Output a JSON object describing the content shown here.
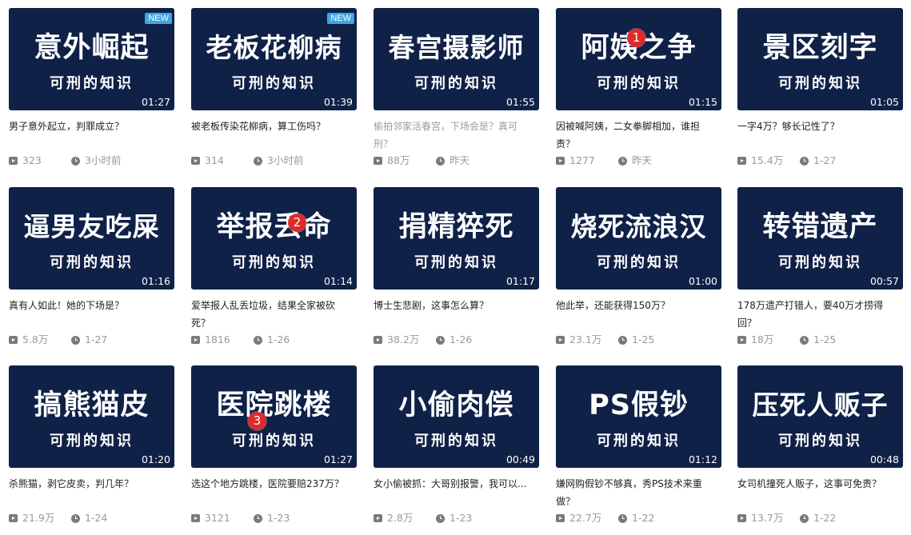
{
  "videos": [
    {
      "title": "意外崛起",
      "subtitle": "可刑的知识",
      "duration": "01:27",
      "badge": "NEW",
      "rank": "",
      "description": "男子意外起立，判罪成立？",
      "plays": "323",
      "time": "3小时前",
      "watched": false
    },
    {
      "title": "老板花柳病",
      "subtitle": "可刑的知识",
      "duration": "01:39",
      "badge": "NEW",
      "rank": "",
      "description": "被老板传染花柳病，算工伤吗？",
      "plays": "314",
      "time": "3小时前",
      "watched": false
    },
    {
      "title": "春宫摄影师",
      "subtitle": "可刑的知识",
      "duration": "01:55",
      "badge": "",
      "rank": "",
      "description": "偷拍邻家活春宫，下场会是？真可刑？",
      "plays": "88万",
      "time": "昨天",
      "watched": true
    },
    {
      "title": "阿姨之争",
      "subtitle": "可刑的知识",
      "duration": "01:15",
      "badge": "",
      "rank": "1",
      "description": "因被喊阿姨，二女拳脚相加，谁担责？",
      "plays": "1277",
      "time": "昨天",
      "watched": false
    },
    {
      "title": "景区刻字",
      "subtitle": "可刑的知识",
      "duration": "01:05",
      "badge": "",
      "rank": "",
      "description": "一字4万？够长记性了？",
      "plays": "15.4万",
      "time": "1-27",
      "watched": false
    },
    {
      "title": "逼男友吃屎",
      "subtitle": "可刑的知识",
      "duration": "01:16",
      "badge": "",
      "rank": "",
      "description": "真有人如此！她的下场是？",
      "plays": "5.8万",
      "time": "1-27",
      "watched": false
    },
    {
      "title": "举报丢命",
      "subtitle": "可刑的知识",
      "duration": "01:14",
      "badge": "",
      "rank": "2",
      "description": "爱举报人乱丢垃圾，结果全家被砍死？",
      "plays": "1816",
      "time": "1-26",
      "watched": false
    },
    {
      "title": "捐精猝死",
      "subtitle": "可刑的知识",
      "duration": "01:17",
      "badge": "",
      "rank": "",
      "description": "博士生悲剧，这事怎么算？",
      "plays": "38.2万",
      "time": "1-26",
      "watched": false
    },
    {
      "title": "烧死流浪汉",
      "subtitle": "可刑的知识",
      "duration": "01:00",
      "badge": "",
      "rank": "",
      "description": "他此举，还能获得150万？",
      "plays": "23.1万",
      "time": "1-25",
      "watched": false
    },
    {
      "title": "转错遗产",
      "subtitle": "可刑的知识",
      "duration": "00:57",
      "badge": "",
      "rank": "",
      "description": "178万遗产打错人，要40万才捞得回？",
      "plays": "18万",
      "time": "1-25",
      "watched": false
    },
    {
      "title": "搞熊猫皮",
      "subtitle": "可刑的知识",
      "duration": "01:20",
      "badge": "",
      "rank": "",
      "description": "杀熊猫，剥它皮卖，判几年？",
      "plays": "21.9万",
      "time": "1-24",
      "watched": false
    },
    {
      "title": "医院跳楼",
      "subtitle": "可刑的知识",
      "duration": "01:27",
      "badge": "",
      "rank": "3",
      "description": "选这个地方跳楼，医院要赔237万？",
      "plays": "3121",
      "time": "1-23",
      "watched": false
    },
    {
      "title": "小偷肉偿",
      "subtitle": "可刑的知识",
      "duration": "00:49",
      "badge": "",
      "rank": "",
      "description": "女小偷被抓：大哥别报警，我可以...",
      "plays": "2.8万",
      "time": "1-23",
      "watched": false
    },
    {
      "title": "PS假钞",
      "subtitle": "可刑的知识",
      "duration": "01:12",
      "badge": "",
      "rank": "",
      "description": "嫌网购假钞不够真，秀PS技术来重做？",
      "plays": "22.7万",
      "time": "1-22",
      "watched": false
    },
    {
      "title": "压死人贩子",
      "subtitle": "可刑的知识",
      "duration": "00:48",
      "badge": "",
      "rank": "",
      "description": "女司机撞死人贩子，这事可免责？",
      "plays": "13.7万",
      "time": "1-22",
      "watched": false
    }
  ],
  "colors": {
    "thumbnail_bg": "#0f2147",
    "new_badge": "#3fa6e0",
    "rank_badge": "#e02a2a",
    "meta_text": "#9a9a9a"
  }
}
